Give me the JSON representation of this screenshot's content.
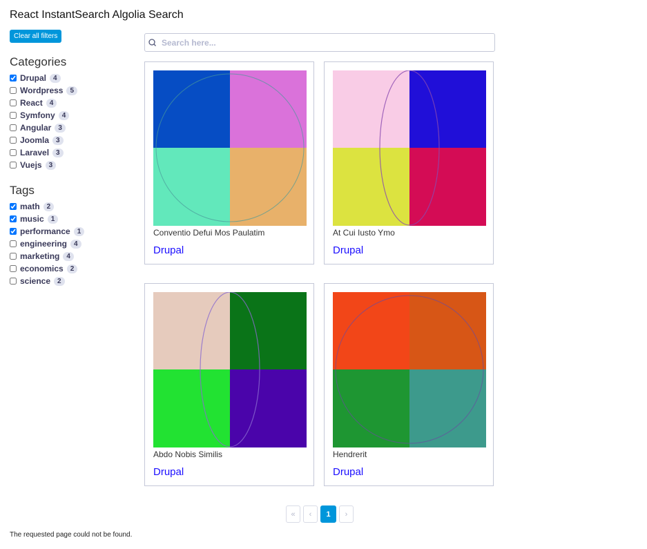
{
  "title": "React InstantSearch Algolia Search",
  "clear_label": "Clear all filters",
  "categories": {
    "heading": "Categories",
    "items": [
      {
        "label": "Drupal",
        "count": "4",
        "checked": true
      },
      {
        "label": "Wordpress",
        "count": "5",
        "checked": false
      },
      {
        "label": "React",
        "count": "4",
        "checked": false
      },
      {
        "label": "Symfony",
        "count": "4",
        "checked": false
      },
      {
        "label": "Angular",
        "count": "3",
        "checked": false
      },
      {
        "label": "Joomla",
        "count": "3",
        "checked": false
      },
      {
        "label": "Laravel",
        "count": "3",
        "checked": false
      },
      {
        "label": "Vuejs",
        "count": "3",
        "checked": false
      }
    ]
  },
  "tags": {
    "heading": "Tags",
    "items": [
      {
        "label": "math",
        "count": "2",
        "checked": true
      },
      {
        "label": "music",
        "count": "1",
        "checked": true
      },
      {
        "label": "performance",
        "count": "1",
        "checked": true
      },
      {
        "label": "engineering",
        "count": "4",
        "checked": false
      },
      {
        "label": "marketing",
        "count": "4",
        "checked": false
      },
      {
        "label": "economics",
        "count": "2",
        "checked": false
      },
      {
        "label": "science",
        "count": "2",
        "checked": false
      }
    ]
  },
  "search": {
    "placeholder": "Search here..."
  },
  "hits": [
    {
      "title": "Conventio Defui Mos Paulatim",
      "category": "Drupal",
      "colors": [
        "#064dc4",
        "#da72da",
        "#62e8bb",
        "#e8b16a"
      ],
      "shape": "circle",
      "stroke": "#4a9a9a"
    },
    {
      "title": "At Cui Iusto Ymo",
      "category": "Drupal",
      "colors": [
        "#f9cce6",
        "#200fd8",
        "#dce340",
        "#d40c55"
      ],
      "shape": "ellipse",
      "stroke": "#8a4ab0"
    },
    {
      "title": "Abdo Nobis Similis",
      "category": "Drupal",
      "colors": [
        "#e6cbbd",
        "#0a7418",
        "#22e232",
        "#4a04aa"
      ],
      "shape": "ellipse",
      "stroke": "#8a6ad0"
    },
    {
      "title": "Hendrerit",
      "category": "Drupal",
      "colors": [
        "#f24618",
        "#d75616",
        "#1e9632",
        "#3d9a8c"
      ],
      "shape": "circle",
      "stroke": "#6a4aa0"
    }
  ],
  "pagination": {
    "first": "«",
    "prev": "‹",
    "current": "1",
    "next": "›"
  },
  "footer": "The requested page could not be found."
}
